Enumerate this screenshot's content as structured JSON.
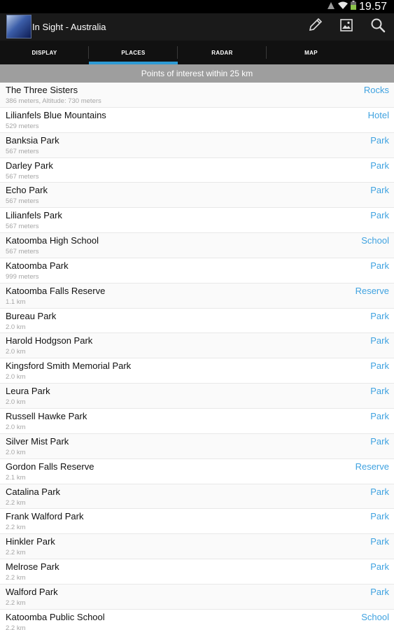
{
  "status_bar": {
    "time": "19.57"
  },
  "action_bar": {
    "title": "In Sight - Australia",
    "actions": [
      "pencil-icon",
      "image-icon",
      "search-icon"
    ]
  },
  "tabs": [
    {
      "label": "DISPLAY",
      "selected": false
    },
    {
      "label": "PLACES",
      "selected": true
    },
    {
      "label": "RADAR",
      "selected": false
    },
    {
      "label": "MAP",
      "selected": false
    }
  ],
  "list_header": "Points of interest within 25 km",
  "places": [
    {
      "name": "The Three Sisters",
      "distance": "386 meters, Altitude: 730 meters",
      "category": "Rocks"
    },
    {
      "name": "Lilianfels Blue Mountains",
      "distance": "529 meters",
      "category": "Hotel"
    },
    {
      "name": "Banksia Park",
      "distance": "567 meters",
      "category": "Park"
    },
    {
      "name": "Darley Park",
      "distance": "567 meters",
      "category": "Park"
    },
    {
      "name": "Echo Park",
      "distance": "567 meters",
      "category": "Park"
    },
    {
      "name": "Lilianfels Park",
      "distance": "567 meters",
      "category": "Park"
    },
    {
      "name": "Katoomba High School",
      "distance": "567 meters",
      "category": "School"
    },
    {
      "name": "Katoomba Park",
      "distance": "999 meters",
      "category": "Park"
    },
    {
      "name": "Katoomba Falls Reserve",
      "distance": "1.1 km",
      "category": "Reserve"
    },
    {
      "name": "Bureau Park",
      "distance": "2.0 km",
      "category": "Park"
    },
    {
      "name": "Harold Hodgson Park",
      "distance": "2.0 km",
      "category": "Park"
    },
    {
      "name": "Kingsford Smith Memorial Park",
      "distance": "2.0 km",
      "category": "Park"
    },
    {
      "name": "Leura Park",
      "distance": "2.0 km",
      "category": "Park"
    },
    {
      "name": "Russell Hawke Park",
      "distance": "2.0 km",
      "category": "Park"
    },
    {
      "name": "Silver Mist Park",
      "distance": "2.0 km",
      "category": "Park"
    },
    {
      "name": "Gordon Falls Reserve",
      "distance": "2.1 km",
      "category": "Reserve"
    },
    {
      "name": "Catalina Park",
      "distance": "2.2 km",
      "category": "Park"
    },
    {
      "name": "Frank Walford Park",
      "distance": "2.2 km",
      "category": "Park"
    },
    {
      "name": "Hinkler Park",
      "distance": "2.2 km",
      "category": "Park"
    },
    {
      "name": "Melrose Park",
      "distance": "2.2 km",
      "category": "Park"
    },
    {
      "name": "Walford Park",
      "distance": "2.2 km",
      "category": "Park"
    },
    {
      "name": "Katoomba Public School",
      "distance": "2.2 km",
      "category": "School"
    }
  ],
  "colors": {
    "accent": "#2e9ad4",
    "category_text": "#3fa2e0",
    "header_bg": "#9e9e9e",
    "action_bar_bg": "#1a1a1a"
  }
}
